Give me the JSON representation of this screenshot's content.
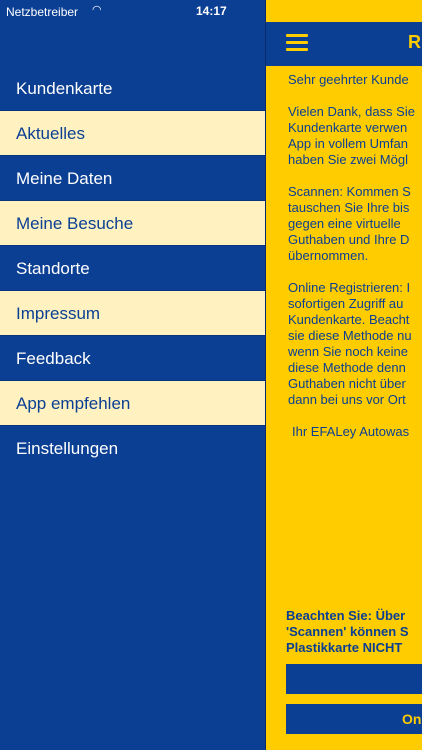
{
  "status_bar": {
    "carrier": "Netzbetreiber",
    "wifi_icon": "wifi-icon",
    "time": "14:17",
    "battery_icon": "battery-icon"
  },
  "menu": {
    "items": [
      {
        "label": "Kundenkarte",
        "highlighted": false
      },
      {
        "label": "Aktuelles",
        "highlighted": true
      },
      {
        "label": "Meine Daten",
        "highlighted": false
      },
      {
        "label": "Meine Besuche",
        "highlighted": true
      },
      {
        "label": "Standorte",
        "highlighted": false
      },
      {
        "label": "Impressum",
        "highlighted": true
      },
      {
        "label": "Feedback",
        "highlighted": false
      },
      {
        "label": "App empfehlen",
        "highlighted": true
      },
      {
        "label": "Einstellungen",
        "highlighted": false
      }
    ]
  },
  "panel": {
    "header_letter": "R",
    "content": {
      "p1": [
        "Sehr geehrter Kunde"
      ],
      "p2": [
        "Vielen Dank, dass Sie",
        "Kundenkarte verwen",
        "App in vollem Umfan",
        "haben Sie zwei Mögl"
      ],
      "p3": [
        "Scannen: Kommen S",
        "tauschen Sie Ihre bis",
        "gegen eine virtuelle",
        "Guthaben und Ihre D",
        "übernommen."
      ],
      "p4": [
        "Online Registrieren: I",
        "sofortigen Zugriff au",
        "Kundenkarte. Beacht",
        "sie diese Methode nu",
        "wenn Sie noch keine",
        "diese Methode denn",
        "Guthaben nicht über",
        "dann bei uns vor Ort"
      ],
      "p5": [
        "Ihr EFALey Autowas"
      ]
    },
    "notice": [
      "Beachten Sie: Über",
      "'Scannen' können S",
      "Plastikkarte NICHT"
    ],
    "button1_label": "",
    "button2_label": "On"
  },
  "colors": {
    "primary_blue": "#0b3f93",
    "yellow": "#ffcc00",
    "light_highlight": "#fff2c0"
  }
}
